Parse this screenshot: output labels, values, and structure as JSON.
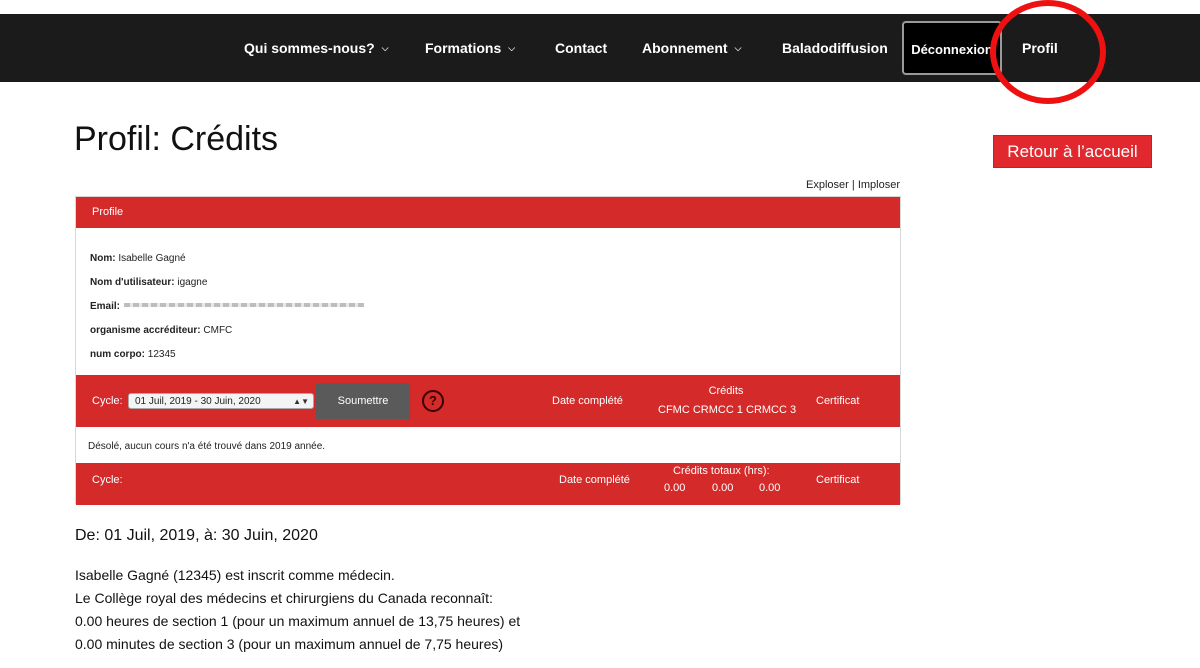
{
  "nav": {
    "items": [
      {
        "label": "Qui sommes-nous?",
        "dropdown": true
      },
      {
        "label": "Formations",
        "dropdown": true
      },
      {
        "label": "Contact",
        "dropdown": false
      },
      {
        "label": "Abonnement",
        "dropdown": true
      },
      {
        "label": "Baladodiffusion",
        "dropdown": false
      }
    ],
    "logout_label": "Déconnexion",
    "profile_label": "Profil",
    "chevron_glyph": "⌵"
  },
  "page": {
    "title": "Profil: Crédits",
    "home_button": "Retour à l’accueil",
    "explode_label": "Exploser",
    "separator": "|",
    "implode_label": "Imploser"
  },
  "profile": {
    "header": "Profile",
    "fields": [
      {
        "label": "Nom:",
        "value": "Isabelle Gagné"
      },
      {
        "label": "Nom d'utilisateur:",
        "value": "igagne"
      },
      {
        "label": "Email:",
        "value": ""
      },
      {
        "label": "organisme accréditeur:",
        "value": "CMFC"
      },
      {
        "label": "num corpo:",
        "value": "12345"
      }
    ]
  },
  "cycle_bar": {
    "cycle_label": "Cycle:",
    "selected_cycle": "01 Juil, 2019 - 30 Juin, 2020",
    "submit_label": "Soumettre",
    "help_glyph": "?",
    "date_label": "Date complété",
    "credits_label": "Crédits",
    "credits_columns": "CFMC CRMCC 1 CRMCC 3",
    "certificate_label": "Certificat"
  },
  "empty_message": "Désolé, aucun cours n'a été trouvé dans 2019 année.",
  "totals_bar": {
    "cycle_label": "Cycle:",
    "date_label": "Date complété",
    "totals_label": "Crédits totaux (hrs):",
    "totals_values": [
      "0.00",
      "0.00",
      "0.00"
    ],
    "certificate_label": "Certificat"
  },
  "summary": {
    "title": "De: 01 Juil, 2019, à: 30 Juin, 2020",
    "lines": [
      "Isabelle Gagné (12345) est inscrit comme médecin.",
      "Le Collège royal des médecins et chirurgiens du Canada reconnaît:",
      "0.00 heures de section 1 (pour un maximum annuel de 13,75 heures) et",
      "0.00 minutes de section 3 (pour un maximum annuel de 7,75 heures)"
    ]
  },
  "colors": {
    "nav_bg": "#1b1b1b",
    "brand_red": "#d42a2a",
    "highlight_red": "#ee1111"
  }
}
